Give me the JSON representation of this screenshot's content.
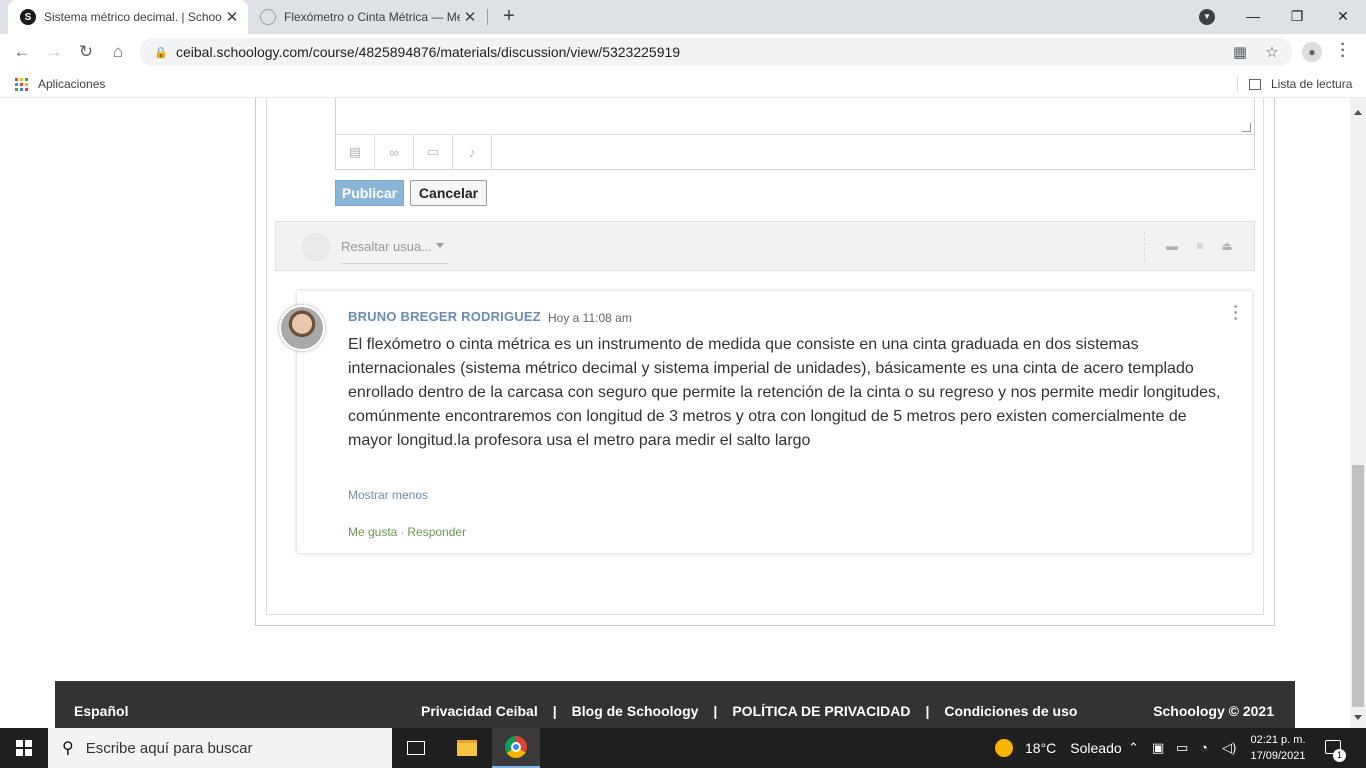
{
  "browser": {
    "tabs": [
      {
        "title": "Sistema métrico decimal. | Schoology",
        "favicon": "schoology-icon",
        "active": true
      },
      {
        "title": "Flexómetro o Cinta Métrica — Medición",
        "favicon": "globe-icon",
        "active": false
      }
    ],
    "url": "ceibal.schoology.com/course/4825894876/materials/discussion/view/5323225919",
    "bookmarks": {
      "apps_label": "Aplicaciones",
      "reading_list_label": "Lista de lectura"
    }
  },
  "reply_editor": {
    "tools": [
      "attach-icon",
      "link-icon",
      "resource-icon",
      "microphone-icon"
    ],
    "publish_label": "Publicar",
    "cancel_label": "Cancelar"
  },
  "filter": {
    "highlight_placeholder": "Resaltar usua..."
  },
  "post": {
    "author": "BRUNO BREGER RODRIGUEZ",
    "time": "Hoy a 11:08 am",
    "body": "El flexómetro o cinta métrica es un instrumento de medida que consiste en una cinta graduada en dos sistemas internacionales (sistema métrico decimal y sistema imperial de unidades), básicamente es una cinta de acero templado enrollado dentro de la carcasa con seguro que permite la retención de la cinta o su regreso y nos permite medir longitudes, comúnmente encontraremos con longitud de 3 metros y otra con longitud de 5 metros pero existen comercialmente de mayor longitud.la profesora usa el metro para medir el salto largo",
    "show_less": "Mostrar menos",
    "like": "Me gusta",
    "reply": "Responder"
  },
  "footer": {
    "language": "Español",
    "links": [
      "Privacidad Ceibal",
      "Blog de Schoology",
      "POLÍTICA DE PRIVACIDAD",
      "Condiciones de uso"
    ],
    "separator": "|",
    "copyright": "Schoology © 2021"
  },
  "taskbar": {
    "search_placeholder": "Escribe aquí para buscar",
    "weather_temp": "18°C",
    "weather_condition": "Soleado",
    "time": "02:21 p. m.",
    "date": "17/09/2021",
    "notification_count": "1"
  },
  "colors": {
    "author_link": "#6a8bb8",
    "action_link": "#6a9a53",
    "publish_button": "#8ab4d8",
    "footer_bg": "#333333"
  }
}
